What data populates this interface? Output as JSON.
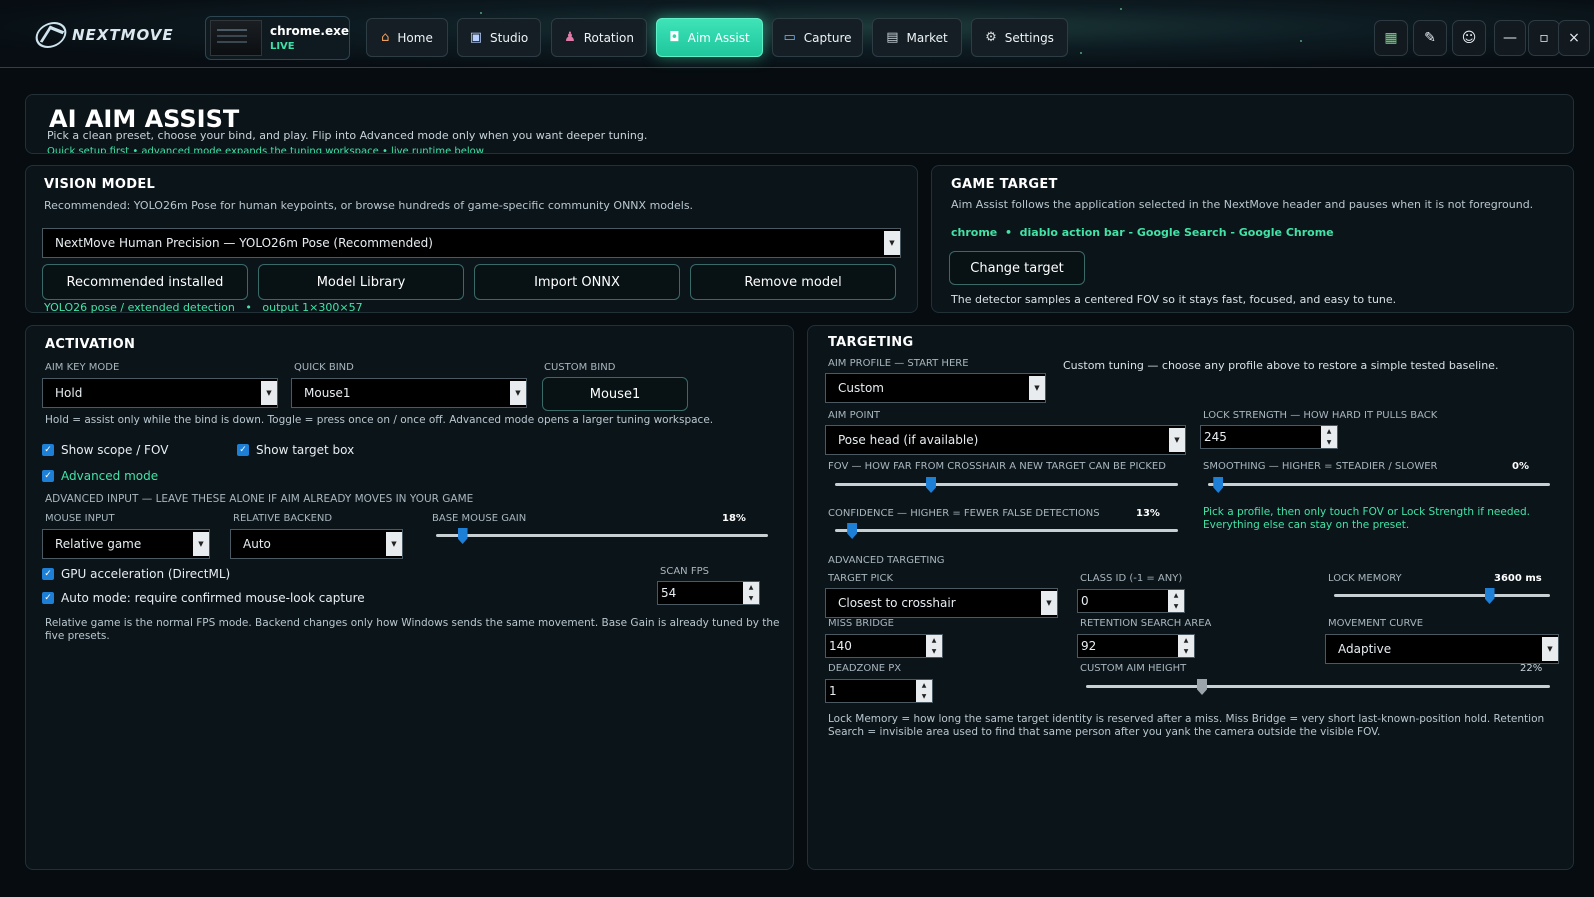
{
  "header": {
    "logo_text": "NEXTMOVE",
    "process": {
      "name": "chrome.exe",
      "status": "LIVE"
    },
    "nav": [
      {
        "label": "Home",
        "icon": "home-icon"
      },
      {
        "label": "Studio",
        "icon": "studio-icon"
      },
      {
        "label": "Rotation",
        "icon": "joystick-icon"
      },
      {
        "label": "Aim Assist",
        "icon": "camera-icon"
      },
      {
        "label": "Capture",
        "icon": "monitor-icon"
      },
      {
        "label": "Market",
        "icon": "market-icon"
      },
      {
        "label": "Settings",
        "icon": "gear-icon"
      }
    ],
    "window_controls": {
      "minimize": "—",
      "maximize": "▫",
      "close": "×"
    }
  },
  "banner": {
    "title": "AI AIM ASSIST",
    "subtitle": "Pick a clean preset, choose your bind, and play. Flip into Advanced mode only when you want deeper tuning.",
    "hint": "Quick setup first • advanced mode expands the tuning workspace • live runtime below"
  },
  "vision": {
    "title": "VISION MODEL",
    "desc": "Recommended: YOLO26m Pose for human keypoints, or browse hundreds of game-specific community ONNX models.",
    "selected_model": "NextMove Human Precision — YOLO26m Pose (Recommended)",
    "buttons": [
      "Recommended installed",
      "Model Library",
      "Import ONNX",
      "Remove model"
    ],
    "status_type": "YOLO26 pose / extended detection",
    "status_sep": "•",
    "status_output": "output 1×300×57"
  },
  "game_target": {
    "title": "GAME TARGET",
    "desc": "Aim Assist follows the application selected in the NextMove header and pauses when it is not foreground.",
    "process": "chrome",
    "sep": "•",
    "window": "diablo action bar - Google Search - Google Chrome",
    "change_button": "Change target",
    "note": "The detector samples a centered FOV so it stays fast, focused, and easy to tune."
  },
  "activation": {
    "title": "ACTIVATION",
    "aim_key_mode_label": "AIM KEY MODE",
    "aim_key_mode": "Hold",
    "quick_bind_label": "QUICK BIND",
    "quick_bind": "Mouse1",
    "custom_bind_label": "CUSTOM BIND",
    "custom_bind": "Mouse1",
    "help": "Hold = assist only while the bind is down. Toggle = press once on / once off. Advanced mode opens a larger tuning workspace.",
    "show_scope": "Show scope / FOV",
    "show_target_box": "Show target box",
    "advanced_mode": "Advanced mode",
    "advanced_input_label": "ADVANCED INPUT — LEAVE THESE ALONE IF AIM ALREADY MOVES IN YOUR GAME",
    "mouse_input_label": "MOUSE INPUT",
    "mouse_input": "Relative game",
    "relative_backend_label": "RELATIVE BACKEND",
    "relative_backend": "Auto",
    "base_gain_label": "BASE MOUSE GAIN",
    "base_gain_value": "18%",
    "base_gain_fraction": 0.08,
    "gpu_accel": "GPU acceleration (DirectML)",
    "auto_mode": "Auto mode: require confirmed mouse-look capture",
    "scan_fps_label": "SCAN FPS",
    "scan_fps": "54",
    "footer": "Relative game is the normal FPS mode. Backend changes only how Windows sends the same movement. Base Gain is already tuned by the",
    "footer2": "five presets."
  },
  "targeting": {
    "title": "TARGETING",
    "aim_profile_label": "AIM PROFILE — START HERE",
    "aim_profile": "Custom",
    "profile_note": "Custom tuning — choose any profile above to restore a simple tested baseline.",
    "aim_point_label": "AIM POINT",
    "aim_point": "Pose head (if available)",
    "lock_strength_label": "LOCK STRENGTH — HOW HARD IT PULLS BACK",
    "lock_strength": "245",
    "fov_label": "FOV — HOW FAR FROM CROSSHAIR A NEW TARGET CAN BE PICKED",
    "fov_fraction": 0.28,
    "smoothing_label": "SMOOTHING — HIGHER = STEADIER / SLOWER",
    "smoothing_value": "0%",
    "smoothing_fraction": 0.03,
    "confidence_label": "CONFIDENCE — HIGHER = FEWER FALSE DETECTIONS",
    "confidence_value": "13%",
    "confidence_fraction": 0.05,
    "tip": "Pick a profile, then only touch FOV or Lock Strength if needed.",
    "tip2": "Everything else can stay on the preset.",
    "advanced_label": "ADVANCED TARGETING",
    "target_pick_label": "TARGET PICK",
    "target_pick": "Closest to crosshair",
    "class_id_label": "CLASS ID (-1 = ANY)",
    "class_id": "0",
    "lock_memory_label": "LOCK MEMORY",
    "lock_memory_value": "3600 ms",
    "lock_memory_fraction": 0.72,
    "miss_bridge_label": "MISS BRIDGE",
    "miss_bridge": "140",
    "retention_label": "RETENTION SEARCH AREA",
    "retention": "92",
    "movement_curve_label": "MOVEMENT CURVE",
    "movement_curve": "Adaptive",
    "deadzone_label": "DEADZONE PX",
    "deadzone": "1",
    "custom_aim_label": "CUSTOM AIM HEIGHT",
    "custom_aim_value": "22%",
    "custom_aim_fraction": 0.25,
    "footer": "Lock Memory = how long the same target identity is reserved after a miss. Miss Bridge = very short last-known-position hold. Retention",
    "footer2": "Search = invisible area used to find that same person after you yank the camera outside the visible FOV."
  }
}
